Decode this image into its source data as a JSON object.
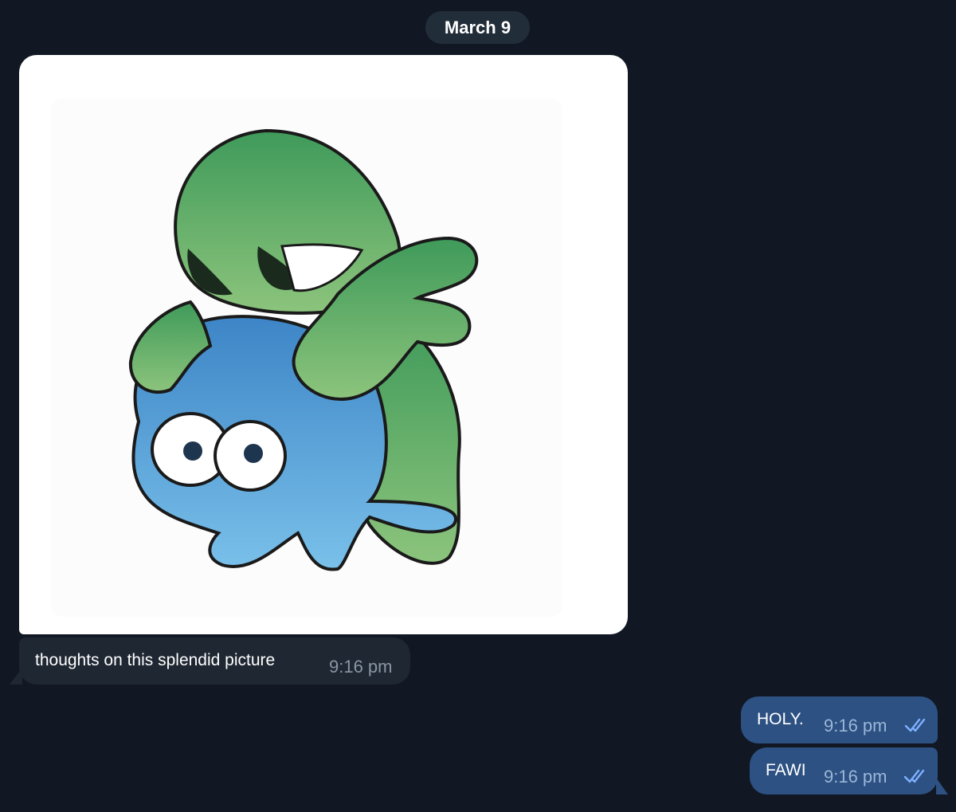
{
  "chat": {
    "date_separator": "March 9",
    "incoming": {
      "image_alt": "Cartoon of a green blob character hugging a blue blob character",
      "caption": "thoughts on this splendid picture",
      "time": "9:16 pm"
    },
    "outgoing": [
      {
        "text": "HOLY.",
        "time": "9:16 pm",
        "status_icon": "double-check-icon"
      },
      {
        "text": "FAWI",
        "time": "9:16 pm",
        "status_icon": "double-check-icon"
      }
    ]
  },
  "colors": {
    "background": "#121823",
    "incoming_bubble": "#1f2733",
    "outgoing_bubble": "#2c5182",
    "date_pill": "#222d3a",
    "check": "#7fb0ff"
  }
}
